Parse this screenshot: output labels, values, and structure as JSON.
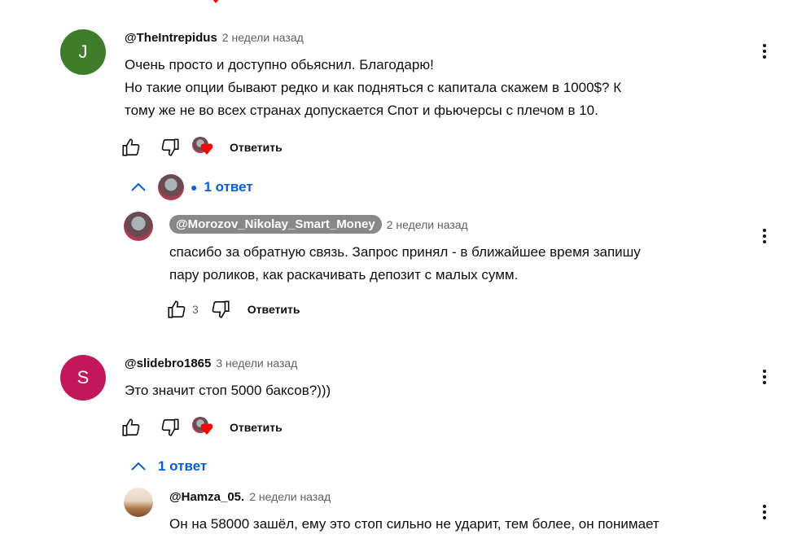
{
  "comments": [
    {
      "avatar_letter": "J",
      "avatar_color": "#3e7d2a",
      "author": "@TheIntrepidus",
      "time": "2 недели назад",
      "lines": [
        "Очень просто и доступно обьяснил. Благодарю!",
        "Но такие опции бывают редко и как подняться с капитала скажем в 1000$? К",
        "тому же не во всех странах допускается Спот и фьючерсы с плечом в 10."
      ],
      "reply_label": "Ответить",
      "replies_label": "1 ответ",
      "reply": {
        "author": "@Morozov_Nikolay_Smart_Money",
        "time": "2 недели назад",
        "lines": [
          "спасибо за обратную связь. Запрос принял - в ближайшее время запишу",
          "пару роликов, как раскачивать депозит с малых сумм."
        ],
        "likes": "3",
        "reply_label": "Ответить"
      }
    },
    {
      "avatar_letter": "S",
      "avatar_color": "#c2185b",
      "author": "@slidebro1865",
      "time": "3 недели назад",
      "lines": [
        "Это значит стоп 5000 баксов?)))"
      ],
      "reply_label": "Ответить",
      "replies_label": "1 ответ",
      "reply": {
        "author": "@Hamza_05.",
        "time": "2 недели назад",
        "lines": [
          "Он на 58000 зашёл, ему это стоп сильно не ударит, тем более, он понимает"
        ]
      }
    }
  ],
  "colors": {
    "link_blue": "#065fd4",
    "heart_red": "#ff0000",
    "secondary_text": "#606060"
  }
}
